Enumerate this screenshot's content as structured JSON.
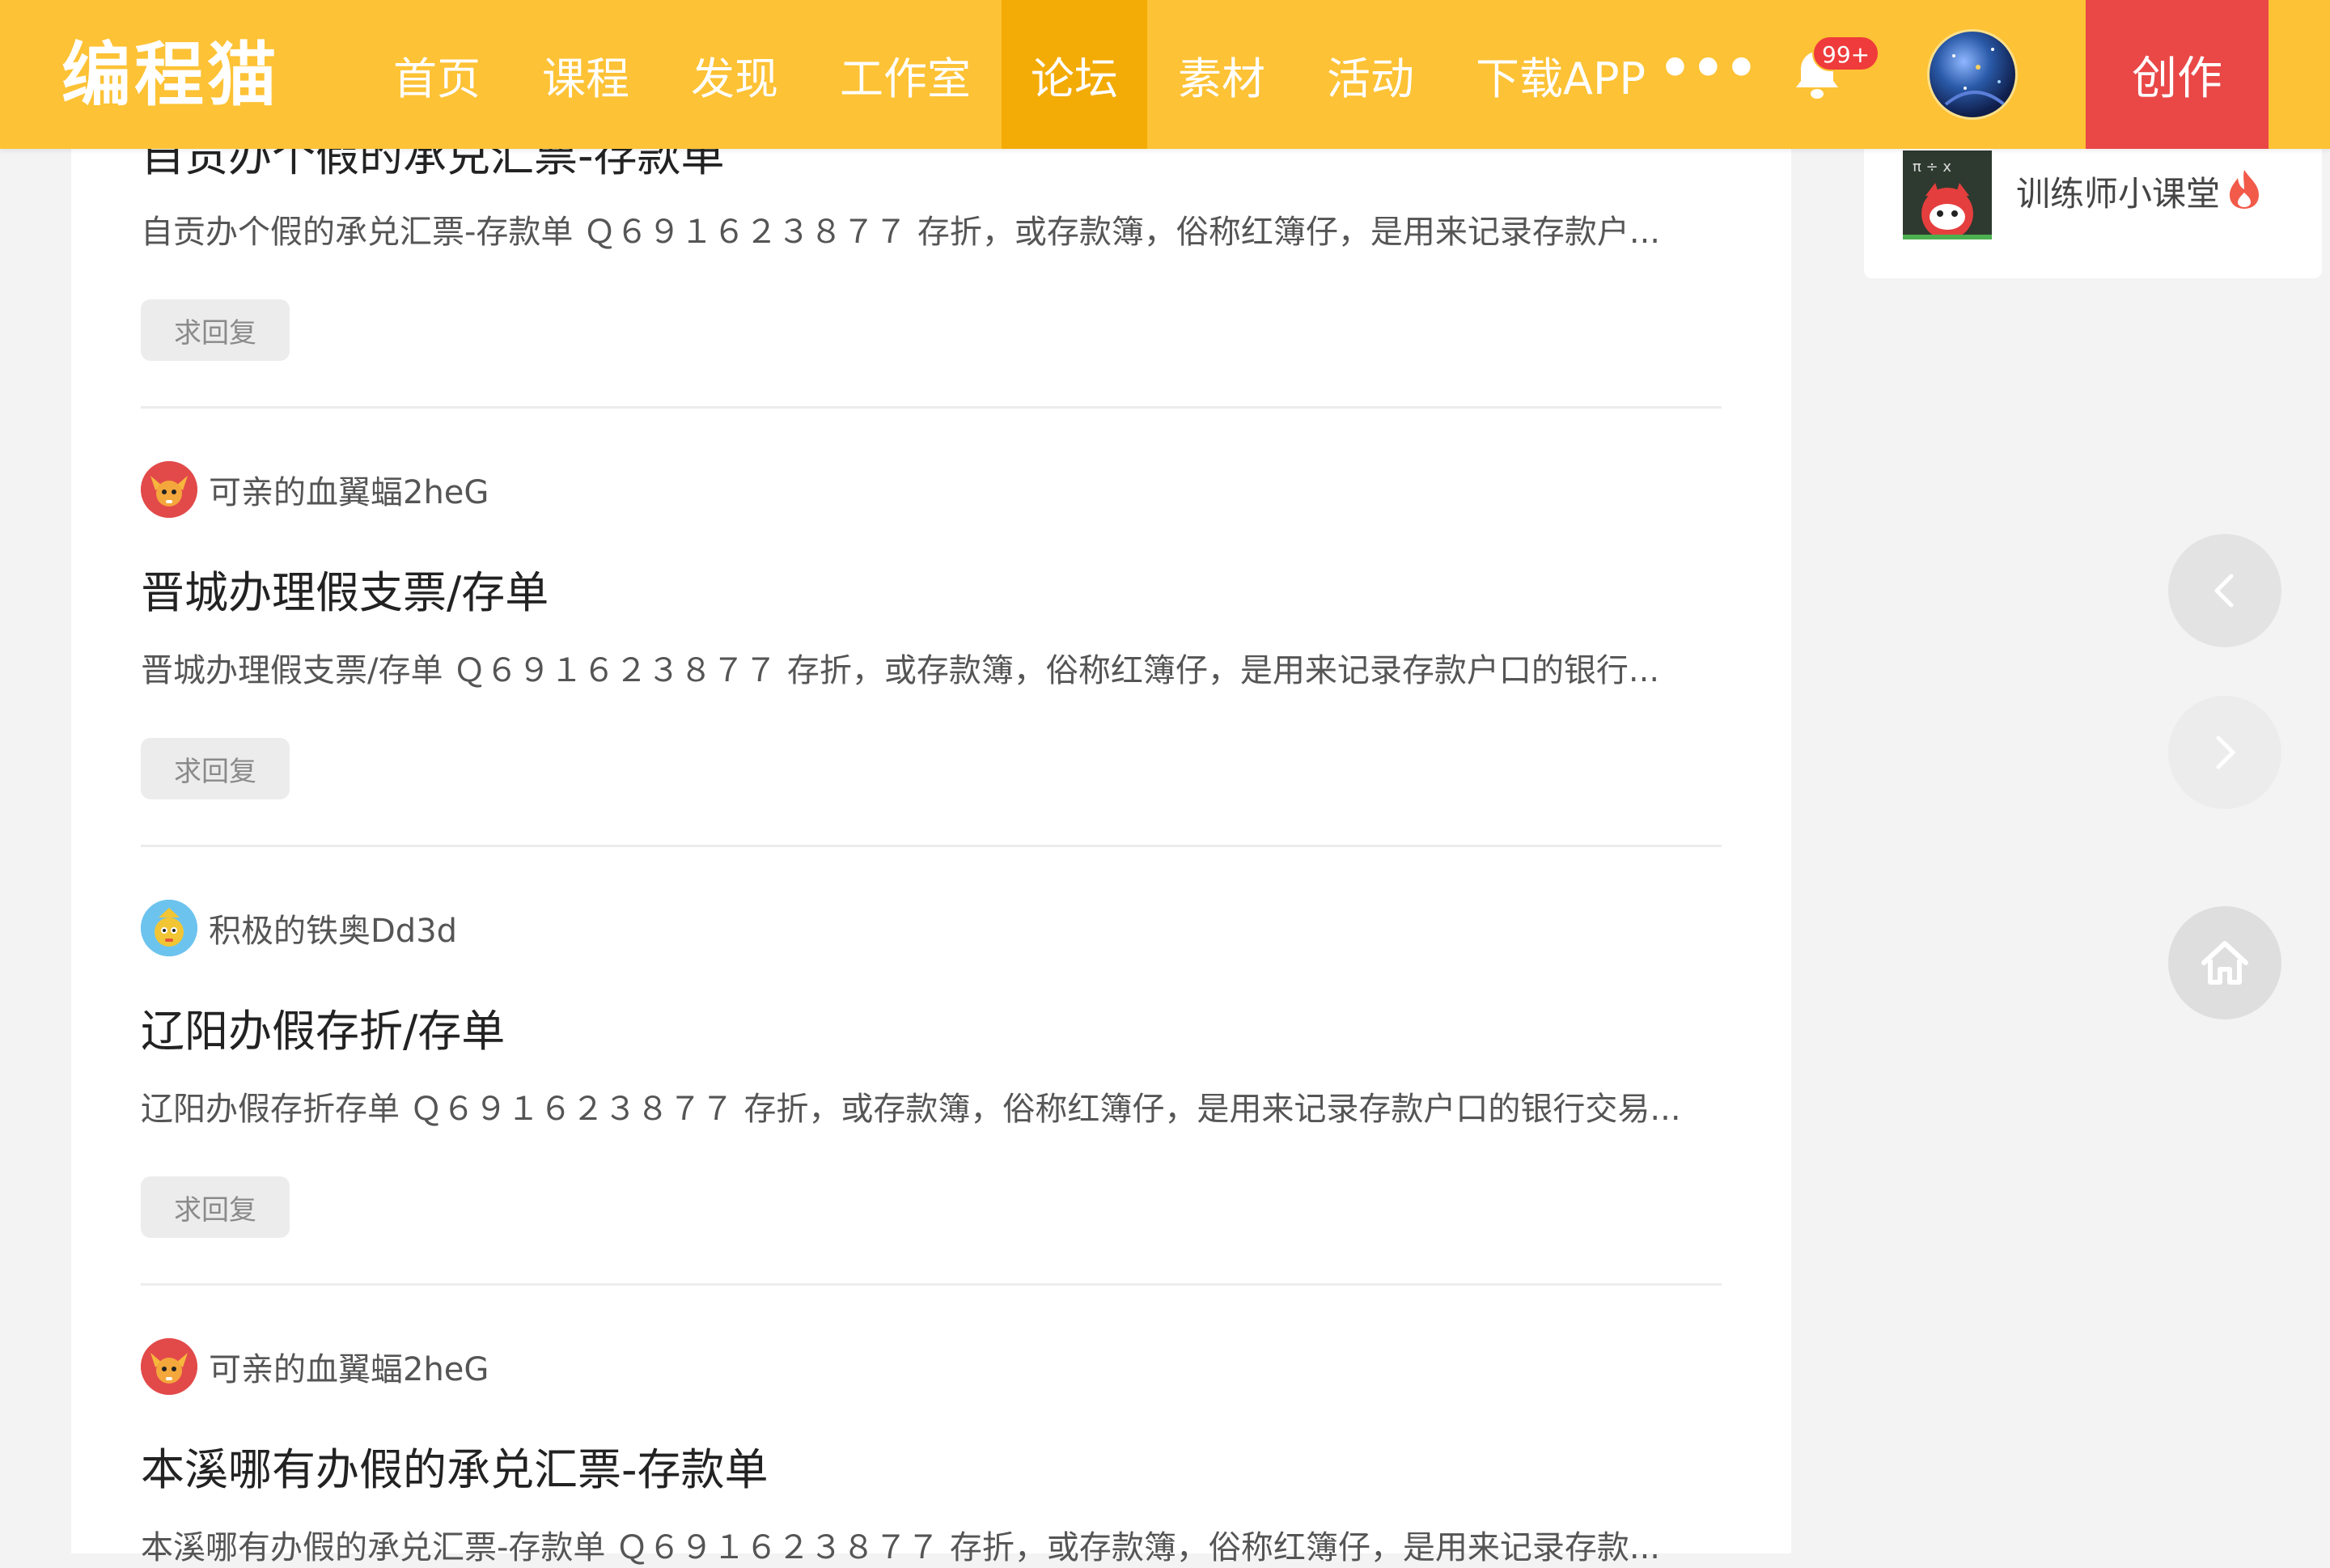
{
  "header": {
    "logo": "编程猫",
    "nav": [
      "首页",
      "课程",
      "发现",
      "工作室",
      "论坛",
      "素材",
      "活动",
      "下载APP"
    ],
    "active_nav": "论坛",
    "more": "•••",
    "notification_badge": "99+",
    "create_label": "创作"
  },
  "sidebar": {
    "item_label": "训练师小课堂"
  },
  "posts": [
    {
      "title": "自贡办个假的承兑汇票-存款单",
      "summary": "自贡办个假的承兑汇票-存款单 Ｑ６９１６２３８７７ 存折，或存款簿，俗称红簿仔，是用来记录存款户...",
      "reply_tag": "求回复"
    },
    {
      "author": "可亲的血翼蝠2heG",
      "title": "晋城办理假支票/存单",
      "summary": "晋城办理假支票/存单 Ｑ６９１６２３８７７ 存折，或存款簿，俗称红簿仔，是用来记录存款户口的银行...",
      "reply_tag": "求回复"
    },
    {
      "author": "积极的铁奥Dd3d",
      "title": "辽阳办假存折/存单",
      "summary": "辽阳办假存折存单 Ｑ６９１６２３８７７ 存折，或存款簿，俗称红簿仔，是用来记录存款户口的银行交易...",
      "reply_tag": "求回复"
    },
    {
      "author": "可亲的血翼蝠2heG",
      "title": "本溪哪有办假的承兑汇票-存款单",
      "summary": "本溪哪有办假的承兑汇票-存款单 Ｑ６９１６２３８７７ 存折，或存款簿，俗称红簿仔，是用来记录存款..."
    }
  ],
  "colors": {
    "header_bg": "#fdc235",
    "active_nav_bg": "#f3ab06",
    "create_bg": "#ea4747",
    "badge_bg": "#ef3b3b"
  },
  "icons": [
    "bell-icon",
    "chevron-left-icon",
    "chevron-right-icon",
    "home-icon",
    "fire-icon"
  ]
}
